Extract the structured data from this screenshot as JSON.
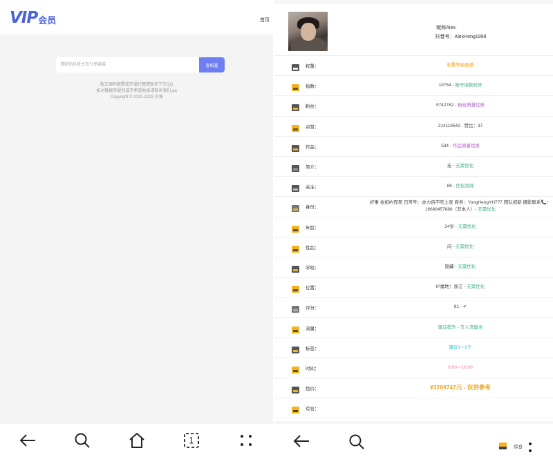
{
  "left": {
    "logo": {
      "vip": "VIP",
      "suffix": "会员"
    },
    "home_link": "首页",
    "search": {
      "placeholder": "请粘贴抖音主页分享链接",
      "button": "查权重"
    },
    "notes": [
      "独立源码部署或开通代理请联系下方QQ",
      "如对数据有疑问或不希望收录请联系我们,qq",
      "Copyright © 2020-2023 小强"
    ],
    "nav": [
      "back-arrow-icon",
      "search-icon",
      "home-icon",
      "tabs-icon",
      "menu-dots-icon"
    ],
    "tab_count": "1"
  },
  "right": {
    "profile": {
      "nickname": "昵称Alex.",
      "douyin_id": "抖音号：AlexHong1998"
    },
    "rows": [
      {
        "icon": "weight-icon",
        "label": "权重：",
        "value": "",
        "note": "权重等级极差",
        "note_color": "orange"
      },
      {
        "icon": "index-icon",
        "label": "指数：",
        "value": "10754 - ",
        "note": "账号指数较好",
        "note_color": "green"
      },
      {
        "icon": "fans-icon",
        "label": "粉丝：",
        "value": "5742762 - ",
        "note": "粉丝质量优质",
        "note_color": "purple"
      },
      {
        "icon": "like-icon",
        "label": "点赞：",
        "value": "214119543 - 赞比：37",
        "note": "",
        "note_color": ""
      },
      {
        "icon": "works-icon",
        "label": "作品：",
        "value": "534 - ",
        "note": "作品质量优质",
        "note_color": "purple"
      },
      {
        "icon": "intro-icon",
        "label": "简介：",
        "value": "无 - ",
        "note": "无需优化",
        "note_color": "green"
      },
      {
        "icon": "follow-icon",
        "label": "关注：",
        "value": "88 - ",
        "note": "优化良好",
        "note_color": "green"
      },
      {
        "icon": "identity-icon",
        "label": "身份：",
        "value": "好事 会如约而至 日常号：@力自不吃土豆 商务：YongHengYH777 团队招新 摄影联系📞：",
        "value2": "18688457888（非本人）- ",
        "note": "无需优化",
        "note_color": "green"
      },
      {
        "icon": "age-icon",
        "label": "年龄：",
        "value": "24岁 - ",
        "note": "无需优化",
        "note_color": "green"
      },
      {
        "icon": "gender-icon",
        "label": "性别：",
        "value": "闷 - ",
        "note": "无需优化",
        "note_color": "green"
      },
      {
        "icon": "school-icon",
        "label": "学校：",
        "value": "隐藏 - ",
        "note": "无需优化",
        "note_color": "green"
      },
      {
        "icon": "location-icon",
        "label": "位置：",
        "value": "IP属地：浙江 - ",
        "note": "无需优化",
        "note_color": "green"
      },
      {
        "icon": "score-icon",
        "label": "评分：",
        "value": "91 - ✔",
        "note": "",
        "note_color": ""
      },
      {
        "icon": "traffic-icon",
        "label": "流量：",
        "value": "",
        "note": "建议提升 - 万人流量池",
        "note_color": "green"
      },
      {
        "icon": "tag-icon",
        "label": "标签：",
        "value": "",
        "note": "建议1～2个",
        "note_color": "cyan"
      },
      {
        "icon": "time-icon",
        "label": "时间：",
        "value": "",
        "note": "8:00～10:00",
        "note_color": "pink"
      },
      {
        "icon": "valuation-icon",
        "label": "估价：",
        "value": "",
        "note": "¥3289747元 - 仅供参考",
        "note_color": "bigorange"
      },
      {
        "icon": "summary-icon",
        "label": "综合：",
        "value": "",
        "note": "",
        "note_color": ""
      }
    ],
    "nav": {
      "mini_label": "综合"
    }
  },
  "colors": {
    "accent": "#6f7ef2",
    "logo": "#4b63d9",
    "green": "#3fae7e",
    "orange": "#f0a21c",
    "purple": "#b05ac7"
  }
}
